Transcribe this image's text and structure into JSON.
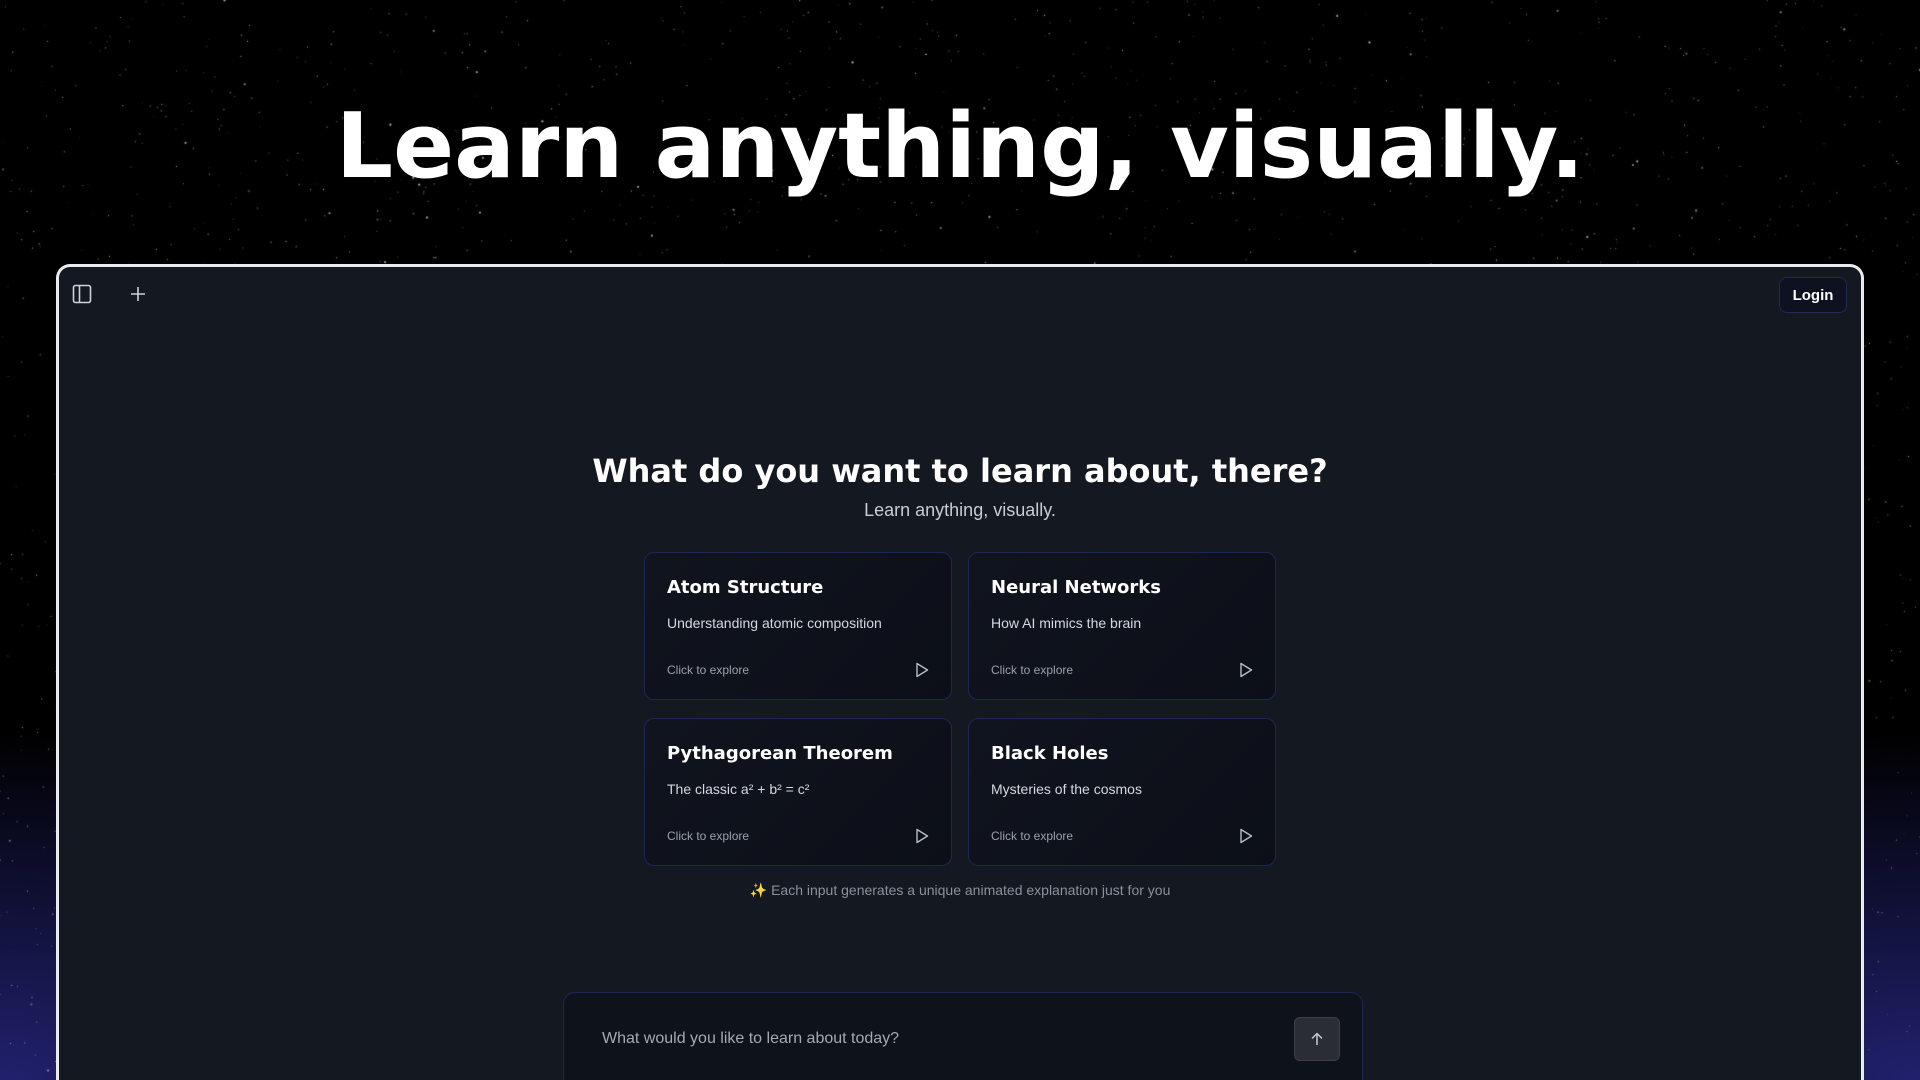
{
  "hero": {
    "title": "Learn anything, visually."
  },
  "app": {
    "topbar": {
      "sidebar_toggle_icon": "sidebar-panel-icon",
      "new_chat_icon": "plus-icon",
      "login_label": "Login"
    },
    "main": {
      "heading": "What do you want to learn about, there?",
      "subtitle": "Learn anything, visually.",
      "cards": [
        {
          "title": "Atom Structure",
          "description": "Understanding atomic composition",
          "cta": "Click to explore",
          "icon": "play-icon"
        },
        {
          "title": "Neural Networks",
          "description": "How AI mimics the brain",
          "cta": "Click to explore",
          "icon": "play-icon"
        },
        {
          "title": "Pythagorean Theorem",
          "description": "The classic a² + b² = c²",
          "cta": "Click to explore",
          "icon": "play-icon"
        },
        {
          "title": "Black Holes",
          "description": "Mysteries of the cosmos",
          "cta": "Click to explore",
          "icon": "play-icon"
        }
      ],
      "footnote": "Each input generates a unique animated explanation just for you",
      "footnote_icon": "sparkle-icon"
    },
    "prompt": {
      "placeholder": "What would you like to learn about today?",
      "send_icon": "arrow-up-icon"
    }
  },
  "colors": {
    "window_bg": "#141820",
    "card_border": "#1c2758",
    "glow": "#6056ff"
  }
}
